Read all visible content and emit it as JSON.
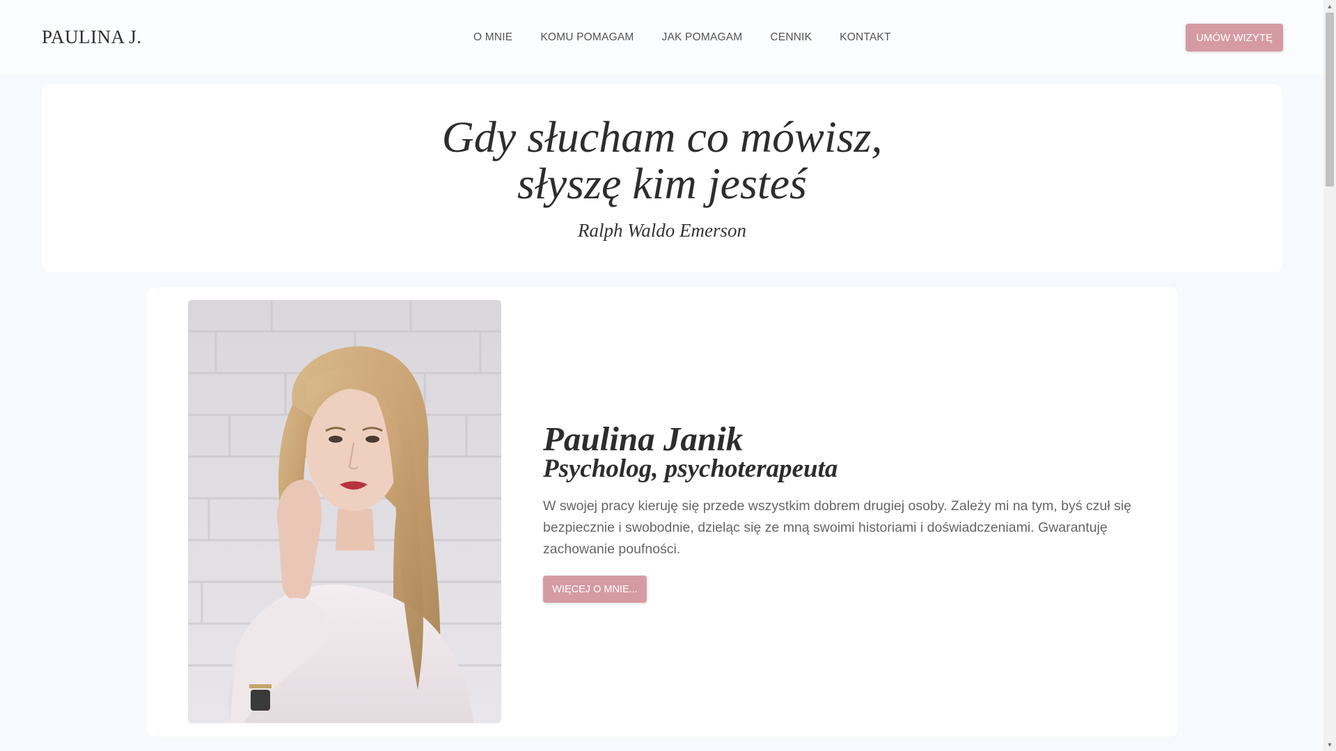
{
  "header": {
    "logo": "PAULINA J.",
    "nav": [
      {
        "label": "O MNIE"
      },
      {
        "label": "KOMU POMAGAM"
      },
      {
        "label": "JAK POMAGAM"
      },
      {
        "label": "CENNIK"
      },
      {
        "label": "KONTAKT"
      }
    ],
    "cta_label": "UMÓW WIZYTĘ"
  },
  "quote": {
    "line1": "Gdy słucham co mówisz,",
    "line2": "słyszę kim jesteś",
    "author": "Ralph Waldo Emerson"
  },
  "profile": {
    "name": "Paulina Janik",
    "role": "Psycholog, psychoterapeuta",
    "description": "W swojej pracy kieruję się przede wszystkim dobrem drugiej osoby. Zależy mi na tym, byś czuł się bezpiecznie i swobodnie, dzieląc się ze mną swoimi historiami i doświadczeniami. Gwarantuję zachowanie poufności.",
    "more_label": "WIĘCEJ O MNIE..."
  },
  "colors": {
    "accent": "#d59ba2",
    "background": "#f6f9fd",
    "card": "#ffffff"
  },
  "icons": {
    "scroll_up": "chevron-up-icon",
    "scroll_down": "chevron-down-icon"
  }
}
